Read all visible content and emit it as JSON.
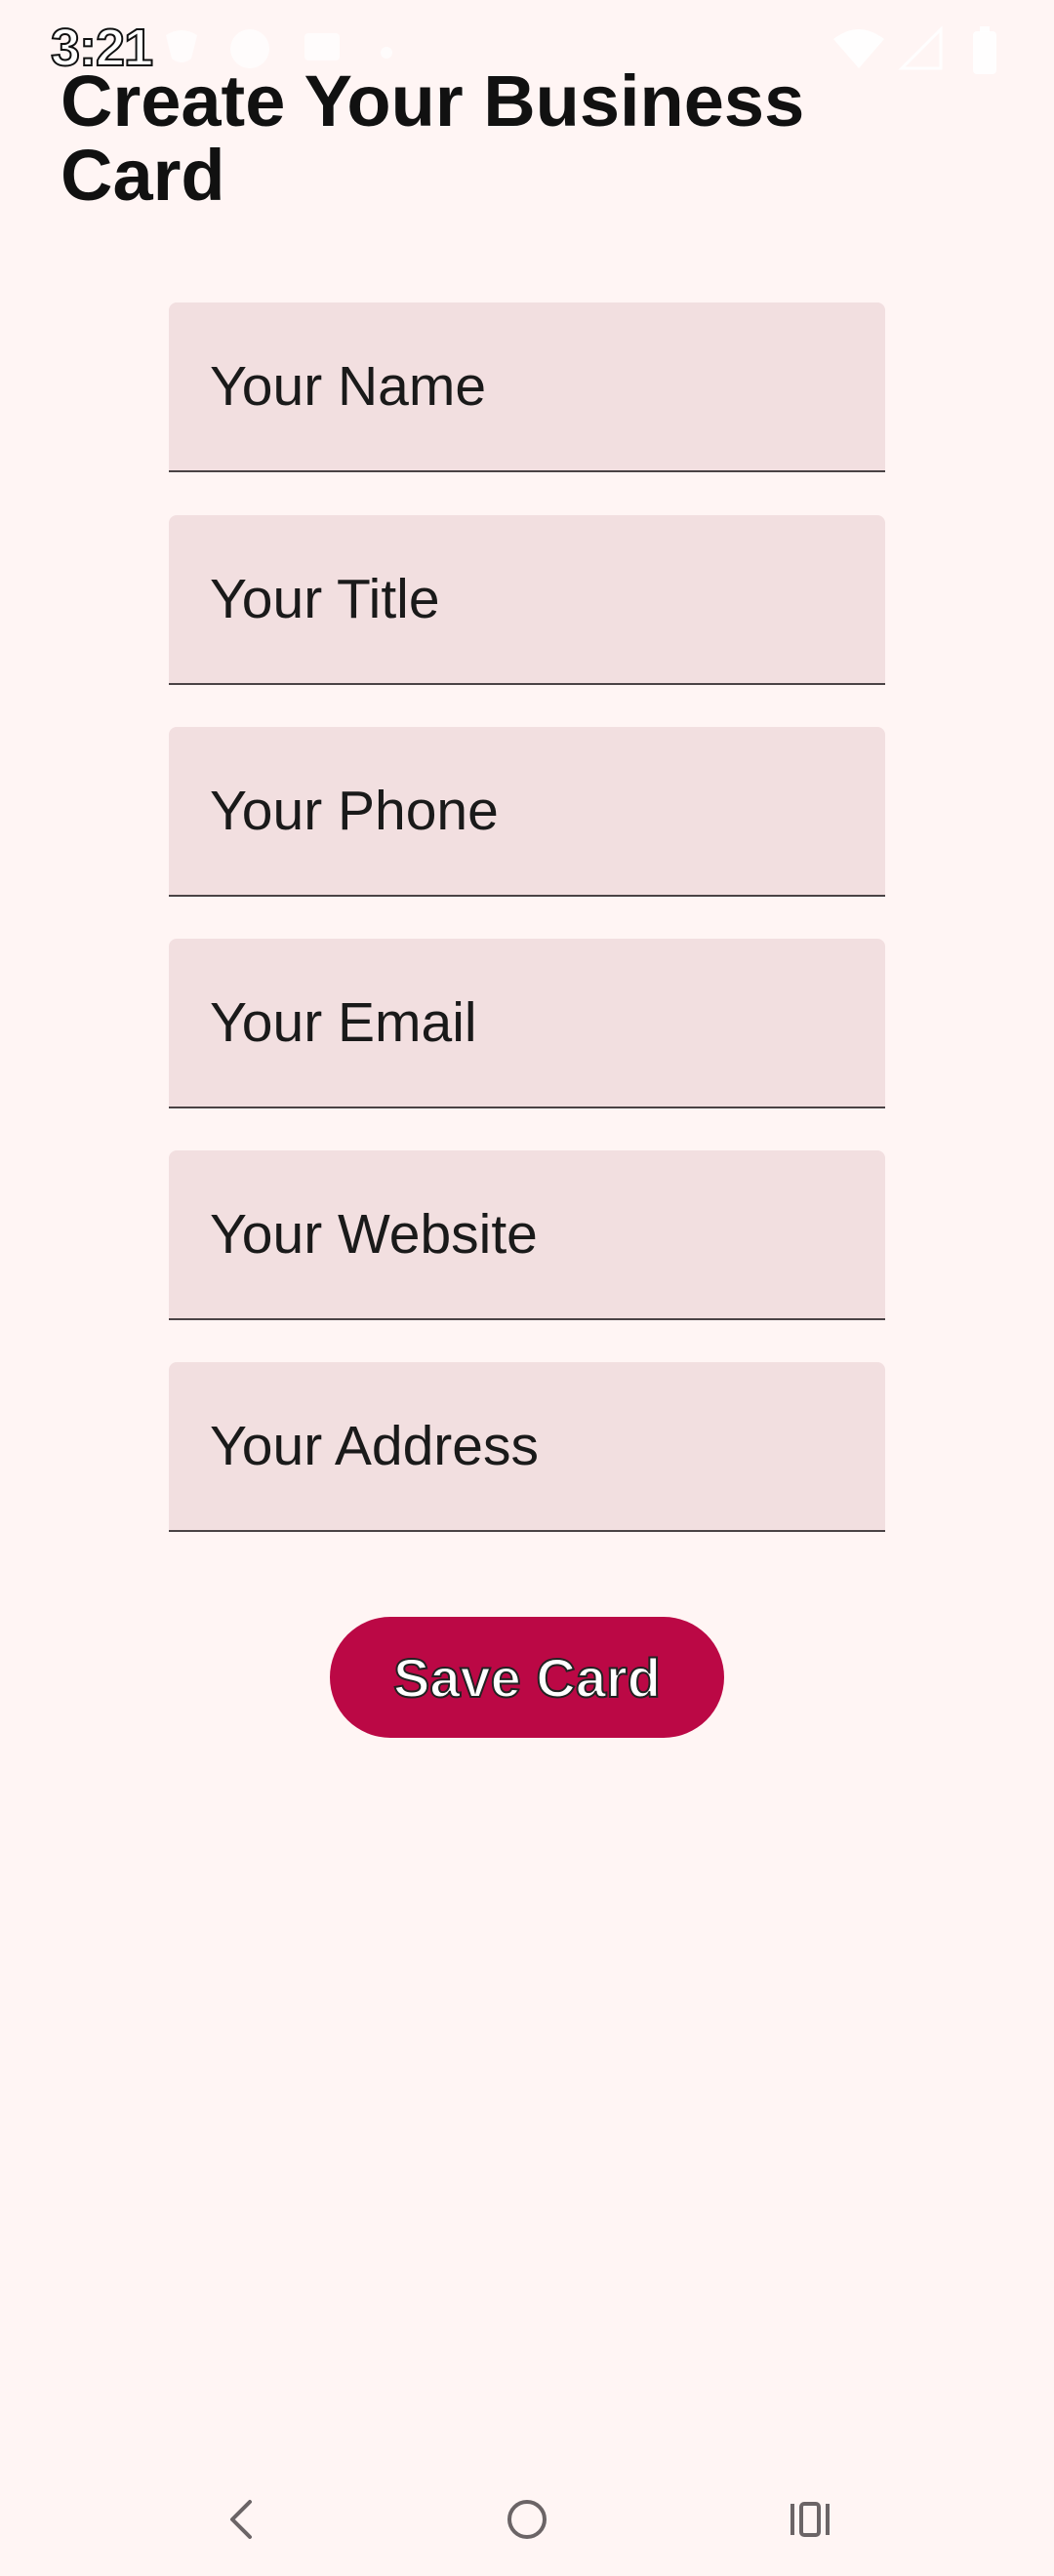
{
  "status_bar": {
    "time": "3:21",
    "icons": [
      "signal-chat-icon",
      "facebook-icon",
      "message-icon",
      "dot-icon",
      "wifi-icon",
      "cellular-signal-icon",
      "battery-icon"
    ]
  },
  "page": {
    "title": "Create Your Business Card"
  },
  "form": {
    "fields": [
      {
        "placeholder": "Your Name",
        "value": ""
      },
      {
        "placeholder": "Your Title",
        "value": ""
      },
      {
        "placeholder": "Your Phone",
        "value": ""
      },
      {
        "placeholder": "Your Email",
        "value": ""
      },
      {
        "placeholder": "Your Website",
        "value": ""
      },
      {
        "placeholder": "Your Address",
        "value": ""
      }
    ],
    "save_label": "Save Card"
  },
  "colors": {
    "background": "#fff5f4",
    "field_background": "#f2dfe0",
    "accent": "#bb0845"
  },
  "nav_bar": {
    "icons": [
      "back-icon",
      "home-icon",
      "recents-icon"
    ]
  }
}
